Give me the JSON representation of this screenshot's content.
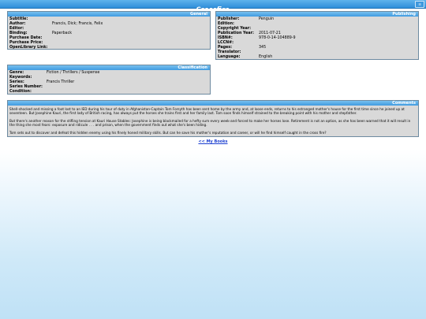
{
  "window": {
    "title": "Crossfire",
    "menu_icon": "menu-icon"
  },
  "general": {
    "heading": "General",
    "fields": [
      {
        "label": "Subtitle:",
        "value": ""
      },
      {
        "label": "Author:",
        "value": "Francis, Dick; Francis, Felix"
      },
      {
        "label": "Editor:",
        "value": ""
      },
      {
        "label": "Binding:",
        "value": "Paperback"
      },
      {
        "label": "Purchase Date:",
        "value": ""
      },
      {
        "label": "Purchase Price:",
        "value": ""
      },
      {
        "label": "OpenLibrary Link:",
        "value": ""
      }
    ]
  },
  "publishing": {
    "heading": "Publishing",
    "fields": [
      {
        "label": "Publisher:",
        "value": "Penguin"
      },
      {
        "label": "Edition:",
        "value": ""
      },
      {
        "label": "Copyright Year:",
        "value": ""
      },
      {
        "label": "Publication Year:",
        "value": "2011-07-21"
      },
      {
        "label": "ISBN#:",
        "value": "978-0-14-104889-9"
      },
      {
        "label": "LCCN#:",
        "value": ""
      },
      {
        "label": "Pages:",
        "value": "345"
      },
      {
        "label": "Translator:",
        "value": ""
      },
      {
        "label": "Language:",
        "value": "English"
      }
    ]
  },
  "classification": {
    "heading": "Classification",
    "fields": [
      {
        "label": "Genre:",
        "value": "Fiction / Thrillers / Suspense"
      },
      {
        "label": "Keywords:",
        "value": ""
      },
      {
        "label": "Series:",
        "value": "Francis Thriller"
      },
      {
        "label": "Series Number:",
        "value": ""
      },
      {
        "label": "Condition:",
        "value": ""
      }
    ]
  },
  "comments": {
    "heading": "Comments",
    "paragraphs": [
      "Shell-shocked and missing a foot lost to an IED during his tour of duty in Afghanistan-Captain Tom Forsyth has been sent home by the army and, at loose ends, returns to his estranged mother's house for the first time since he joined up at seventeen. But Josephine Kauri, the first lady of British racing, has always put the horses she trains first and her family last. Tom soon finds himself strained to the breaking point with his mother and stepfather.",
      "But there's another reason for the stifling tension at Kauri House Stables: Josephine is being blackmailed for a hefty sum every week-and forced to make her horses lose. Retirement is not an option, as she has been warned that it will result in the thing she most fears: exposure and ridicule . . . and prison, when the government finds out what she's been hiding.",
      "Tom sets out to discover and defeat this hidden enemy using his finely honed military skills. But can he save his mother's reputation and career, or will he find himself caught in the cross fire?"
    ]
  },
  "nav": {
    "back_label": "<< My Books"
  }
}
